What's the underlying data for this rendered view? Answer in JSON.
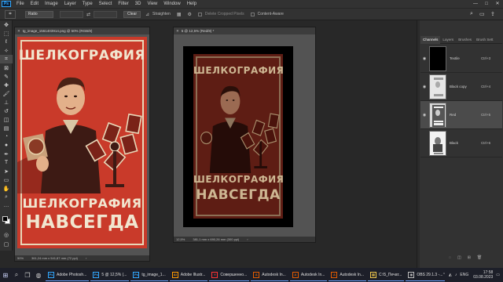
{
  "app": {
    "menu": [
      "File",
      "Edit",
      "Image",
      "Layer",
      "Type",
      "Select",
      "Filter",
      "3D",
      "View",
      "Window",
      "Help"
    ],
    "logo": "Ps"
  },
  "options": {
    "ratio": "Ratio",
    "clear": "Clear",
    "straighten": "Straighten",
    "delete_cropped": "Delete Cropped Pixels",
    "content_aware": "Content-Aware"
  },
  "doc1": {
    "tab": "tg_image_1561403914.png @ 50% (RGB/8)",
    "zoom": "50%",
    "size": "361,24 mm x 541,87 mm (72 ppi)"
  },
  "doc2": {
    "tab": "5 @ 12,5% (Red/8) *",
    "zoom": "12,5%",
    "size": "381,1 mm x 690,26 mm (300 ppi)"
  },
  "poster": {
    "line1": "ШЕЛКОГРАФИЯ",
    "line2": "ШЕЛКОГРАФИЯ",
    "line3": "НАВСЕГДА"
  },
  "panel": {
    "tabs": [
      "Channels",
      "Layers",
      "Brushes",
      "Brush Sett"
    ],
    "channels": [
      {
        "name": "Textile",
        "shortcut": "Ctrl+3"
      },
      {
        "name": "Black copy",
        "shortcut": "Ctrl+4"
      },
      {
        "name": "Red",
        "shortcut": "Ctrl+5"
      },
      {
        "name": "Black",
        "shortcut": "Ctrl+6"
      }
    ]
  },
  "taskbar": {
    "apps": [
      {
        "label": "Adobe Photosh...",
        "icon": "Ps",
        "color": "#31a8ff"
      },
      {
        "label": "5 @ 12,5% (...",
        "icon": "Ps",
        "color": "#31a8ff"
      },
      {
        "label": "tg_image_1...",
        "icon": "Ps",
        "color": "#31a8ff"
      },
      {
        "label": "Adobe Illustr...",
        "icon": "Ai",
        "color": "#ff9a00"
      },
      {
        "label": "Совершенно...",
        "icon": "Y",
        "color": "#ff3333"
      },
      {
        "label": "Autodesk In...",
        "icon": "A",
        "color": "#e35b00"
      },
      {
        "label": "Autodesk In...",
        "icon": "A",
        "color": "#e35b00"
      },
      {
        "label": "Autodesk In...",
        "icon": "A",
        "color": "#e35b00"
      },
      {
        "label": "C:\\5_Печат...",
        "icon": "▤",
        "color": "#f2c94c"
      },
      {
        "label": "OBS 29.1.3 -...",
        "icon": "◉",
        "color": "#bbbbbb"
      }
    ],
    "lang": "ENG",
    "time": "17:58",
    "date": "03.08.2023"
  }
}
